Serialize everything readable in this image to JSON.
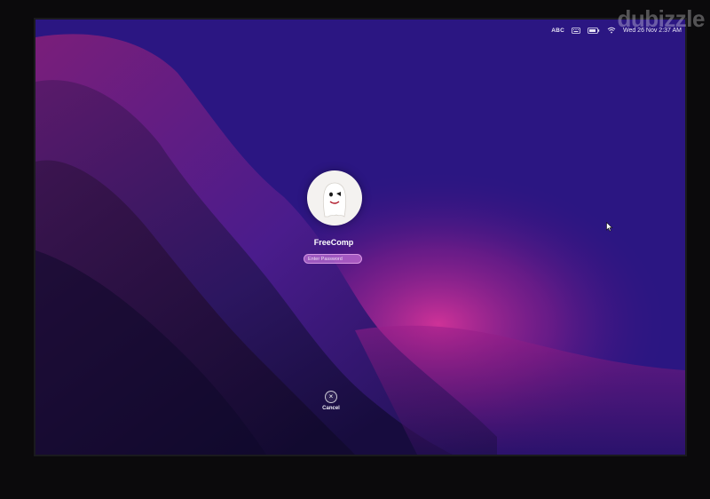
{
  "menubar": {
    "input_source": "ABC",
    "datetime": "Wed 26 Nov 2:37 AM",
    "icons": [
      "keyboard-icon",
      "battery-icon",
      "wifi-icon"
    ]
  },
  "login": {
    "user_name": "FreeComp",
    "password_placeholder": "Enter Password",
    "cancel_label": "Cancel"
  },
  "watermark": "dubizzle",
  "colors": {
    "accent_field": "#e88cf0",
    "wallpaper_top": "#2a1480",
    "wallpaper_magenta": "#d0309a"
  }
}
